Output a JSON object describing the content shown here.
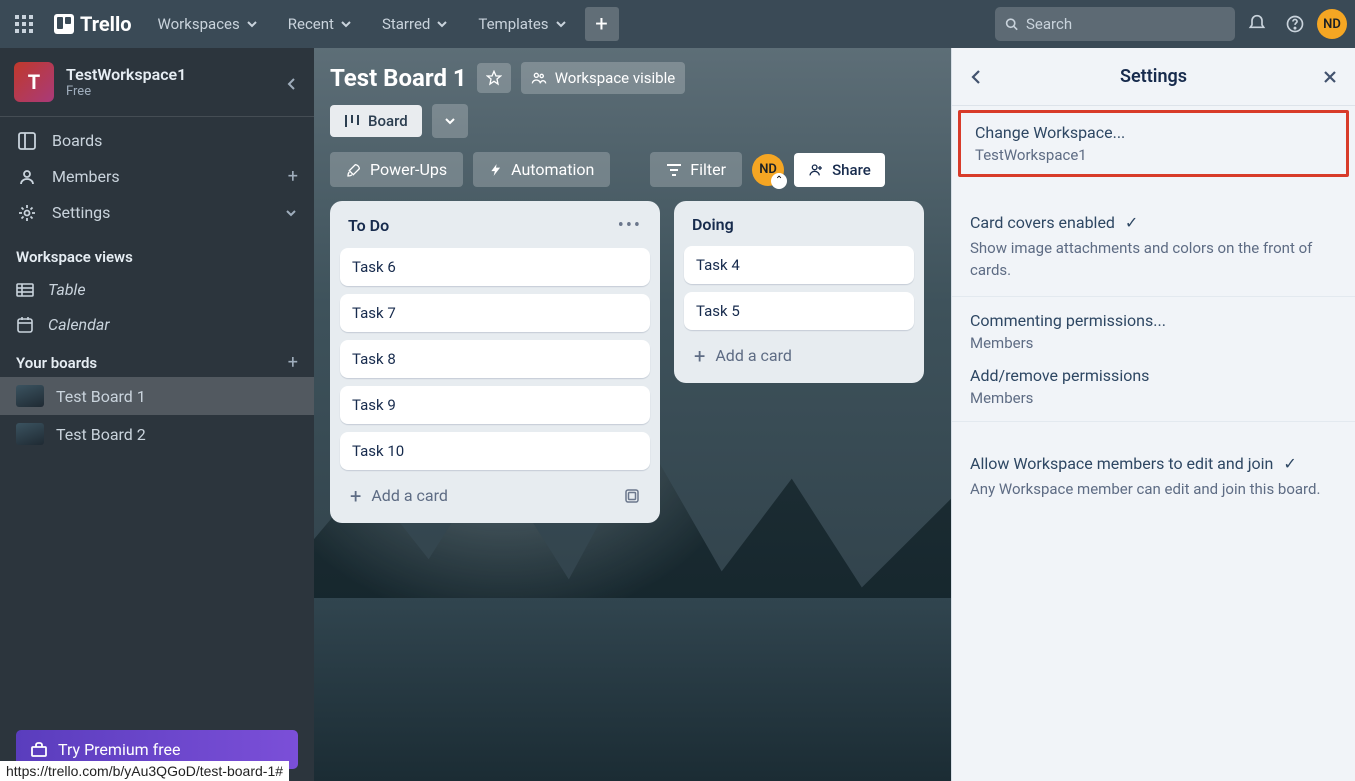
{
  "topbar": {
    "logo_text": "Trello",
    "nav": [
      "Workspaces",
      "Recent",
      "Starred",
      "Templates"
    ],
    "search_placeholder": "Search",
    "avatar_initials": "ND"
  },
  "sidebar": {
    "workspace_initial": "T",
    "workspace_name": "TestWorkspace1",
    "workspace_plan": "Free",
    "items": [
      {
        "label": "Boards"
      },
      {
        "label": "Members"
      },
      {
        "label": "Settings"
      }
    ],
    "views_heading": "Workspace views",
    "views": [
      {
        "label": "Table"
      },
      {
        "label": "Calendar"
      }
    ],
    "your_boards_heading": "Your boards",
    "boards": [
      {
        "label": "Test Board 1",
        "active": true
      },
      {
        "label": "Test Board 2",
        "active": false
      }
    ],
    "premium_label": "Try Premium free"
  },
  "board": {
    "title": "Test Board 1",
    "visibility_label": "Workspace visible",
    "view_label": "Board",
    "powerups_label": "Power-Ups",
    "automation_label": "Automation",
    "filter_label": "Filter",
    "share_label": "Share",
    "member_initials": "ND",
    "lists": [
      {
        "title": "To Do",
        "cards": [
          "Task 6",
          "Task 7",
          "Task 8",
          "Task 9",
          "Task 10"
        ],
        "add_label": "Add a card"
      },
      {
        "title": "Doing",
        "cards": [
          "Task 4",
          "Task 5"
        ],
        "add_label": "Add a card"
      }
    ]
  },
  "settings": {
    "title": "Settings",
    "change_workspace_label": "Change Workspace...",
    "change_workspace_value": "TestWorkspace1",
    "covers_title": "Card covers enabled",
    "covers_desc": "Show image attachments and colors on the front of cards.",
    "commenting_title": "Commenting permissions...",
    "commenting_value": "Members",
    "addremove_title": "Add/remove permissions",
    "addremove_value": "Members",
    "allow_title": "Allow Workspace members to edit and join",
    "allow_desc": "Any Workspace member can edit and join this board."
  },
  "status_url": "https://trello.com/b/yAu3QGoD/test-board-1#"
}
